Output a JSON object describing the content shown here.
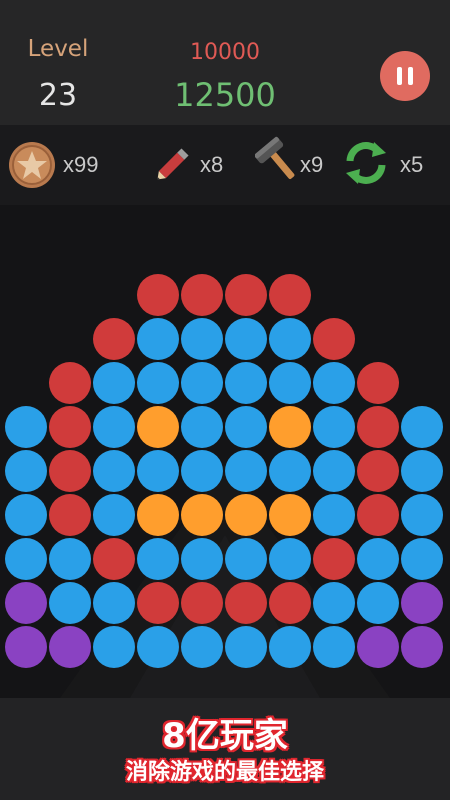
{
  "header": {
    "level_label": "Level",
    "level_value": "23",
    "target_score": "10000",
    "current_score": "12500"
  },
  "powerups": [
    {
      "name": "star-coin",
      "count": "x99"
    },
    {
      "name": "pencil",
      "count": "x8"
    },
    {
      "name": "hammer",
      "count": "x9"
    },
    {
      "name": "refresh",
      "count": "x5"
    }
  ],
  "colors": {
    "R": "#d03b3b",
    "B": "#2aa0e8",
    "O": "#ff9e2d",
    "P": "#8a42c2"
  },
  "board": {
    "rows": [
      "   RRRR   ",
      "  RBBBBR  ",
      " RBBBBBBR ",
      "BRBOBBOBRB",
      "BRBBBBBBRB",
      "BRBOOOOBRB",
      "BBRBBBBRBB",
      "PBBRRRRBBP",
      "PPBBBBBBPP"
    ]
  },
  "footer": {
    "title": "8亿玩家",
    "subtitle": "消除游戏的最佳选择"
  }
}
